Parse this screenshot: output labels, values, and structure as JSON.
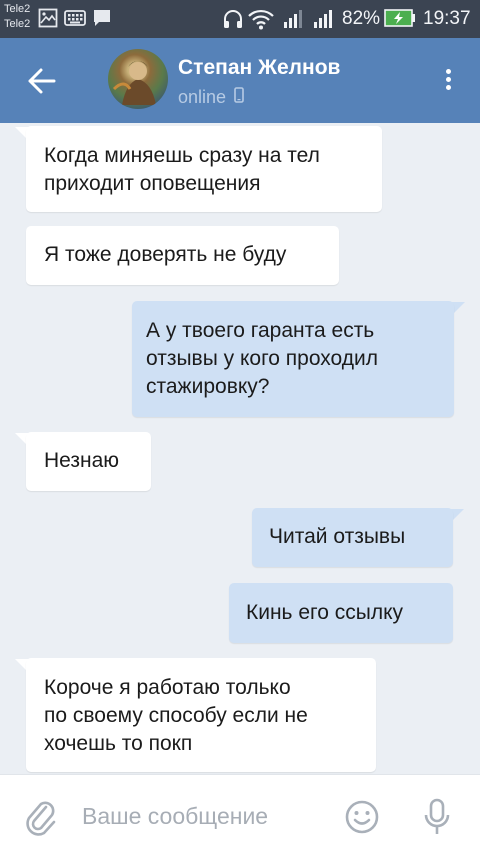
{
  "status_bar": {
    "carrier_1": "Tele2",
    "carrier_2": "Tele2",
    "battery_percent": "82%",
    "time": "19:37",
    "icons": [
      "image-icon",
      "keyboard-icon",
      "chat-icon",
      "headphones-icon",
      "wifi-icon",
      "signal-icon",
      "signal-icon",
      "battery-charging-icon"
    ]
  },
  "header": {
    "contact_name": "Степан Желнов",
    "status": "online",
    "icons": [
      "back-arrow-icon",
      "avatar",
      "phone-icon",
      "more-vertical-icon"
    ]
  },
  "messages": [
    {
      "direction": "in",
      "lines": [
        "Когда миняешь сразу на тел",
        "приходит оповещения"
      ]
    },
    {
      "direction": "in",
      "lines": [
        "Я тоже доверять не буду"
      ]
    },
    {
      "direction": "out",
      "lines": [
        "А у твоего гаранта есть",
        "отзывы у кого проходил",
        "стажировку?"
      ]
    },
    {
      "direction": "in",
      "lines": [
        "Незнаю"
      ]
    },
    {
      "direction": "out",
      "lines": [
        "Читай отзывы"
      ]
    },
    {
      "direction": "out",
      "lines": [
        "Кинь его ссылку"
      ]
    },
    {
      "direction": "in",
      "lines": [
        "Короче я работаю только",
        "по своему способу если не",
        "хочешь то покп"
      ]
    }
  ],
  "input_bar": {
    "placeholder": "Ваше сообщение",
    "value": "",
    "icons": [
      "paperclip-icon",
      "emoji-icon",
      "microphone-icon"
    ]
  },
  "colors": {
    "header_bg": "#5682b8",
    "status_bar_bg": "#3b4452",
    "chat_bg": "#ebeff4",
    "incoming_bubble": "#ffffff",
    "outgoing_bubble": "#cfe0f4",
    "battery_green": "#4caf50"
  }
}
